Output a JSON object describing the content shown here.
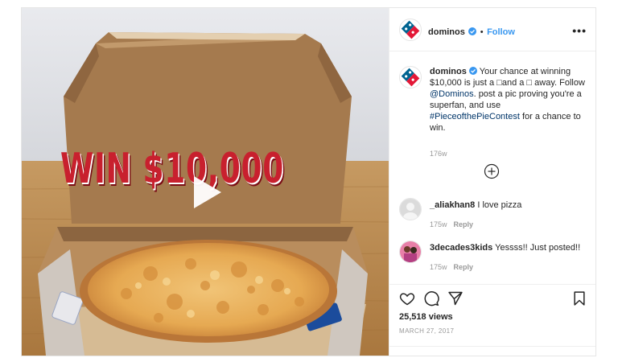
{
  "post": {
    "username": "dominos",
    "follow_label": "Follow",
    "separator": "•",
    "more_label": "•••",
    "media": {
      "overlay_text": "WIN $10,000"
    },
    "caption": {
      "username": "dominos",
      "text_part1": "Your chance at winning $10,000 is just a ",
      "glyph1": "□",
      "text_part2": "and a ",
      "glyph2": "□",
      "text_part3": " away. Follow ",
      "mention": "@Dominos",
      "text_part4": ". post a pic proving you're a superfan, and use ",
      "hashtag": "#PieceofthePieContest",
      "text_part5": " for a chance to win.",
      "time": "176w"
    },
    "comments": [
      {
        "username": "_aliakhan8",
        "text": "I love pizza",
        "time": "175w",
        "reply_label": "Reply"
      },
      {
        "username": "3decades3kids",
        "text": "Yessss!! Just posted!!",
        "time": "175w",
        "reply_label": "Reply"
      }
    ],
    "views": "25,518 views",
    "date": "MARCH 27, 2017"
  },
  "colors": {
    "accent_link": "#3897f0",
    "dominos_blue": "#006491",
    "dominos_red": "#e31837",
    "overlay_red": "#c8202e"
  },
  "icons": [
    "dominos-logo-icon",
    "verified-badge-icon",
    "play-icon",
    "load-more-plus-icon",
    "heart-icon",
    "comment-icon",
    "share-icon",
    "bookmark-icon",
    "default-avatar-icon"
  ]
}
